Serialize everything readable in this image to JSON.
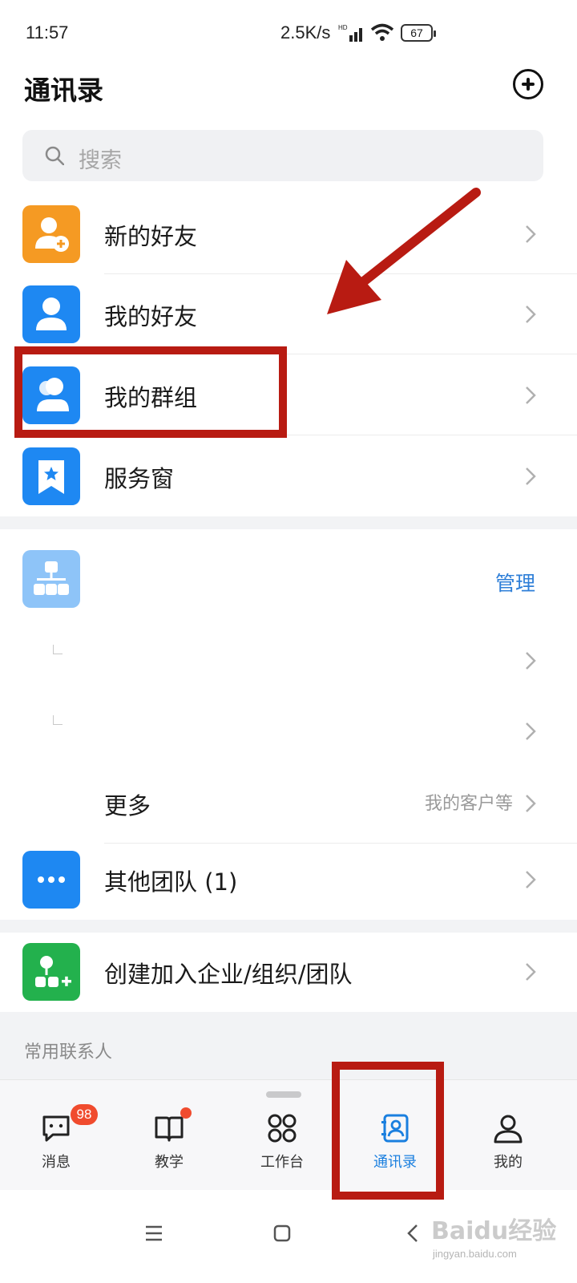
{
  "status_bar": {
    "time": "11:57",
    "network_speed": "2.5K/s",
    "signal_label": "HD",
    "battery": "67"
  },
  "header": {
    "title": "通讯录"
  },
  "search": {
    "placeholder": "搜索"
  },
  "top_items": [
    {
      "label": "新的好友",
      "icon": "add-contact-icon",
      "color": "#f59a23"
    },
    {
      "label": "我的好友",
      "icon": "person-icon",
      "color": "#1e88f2"
    },
    {
      "label": "我的群组",
      "icon": "group-icon",
      "color": "#1e88f2"
    },
    {
      "label": "服务窗",
      "icon": "bookmark-star-icon",
      "color": "#1e88f2"
    }
  ],
  "org": {
    "icon": "org-chart-icon",
    "icon_color": "#8ec4f8",
    "manage_label": "管理"
  },
  "more": {
    "label": "更多",
    "sub": "我的客户等"
  },
  "other_teams": {
    "label": "其他团队 (1)",
    "icon": "more-dots-icon",
    "color": "#1e88f2"
  },
  "create_org": {
    "label": "创建加入企业/组织/团队",
    "icon": "org-add-icon",
    "color": "#23b14d"
  },
  "frequent": {
    "label": "常用联系人"
  },
  "tabbar": {
    "tabs": [
      {
        "label": "消息",
        "badge": "98",
        "icon": "message-icon"
      },
      {
        "label": "教学",
        "icon": "book-icon"
      },
      {
        "label": "工作台",
        "icon": "workbench-icon"
      },
      {
        "label": "通讯录",
        "icon": "contacts-icon",
        "active": true
      },
      {
        "label": "我的",
        "icon": "profile-icon"
      }
    ],
    "active_color": "#1a7fdf"
  },
  "watermark": {
    "logo": "Baidu经验",
    "url": "jingyan.baidu.com"
  }
}
